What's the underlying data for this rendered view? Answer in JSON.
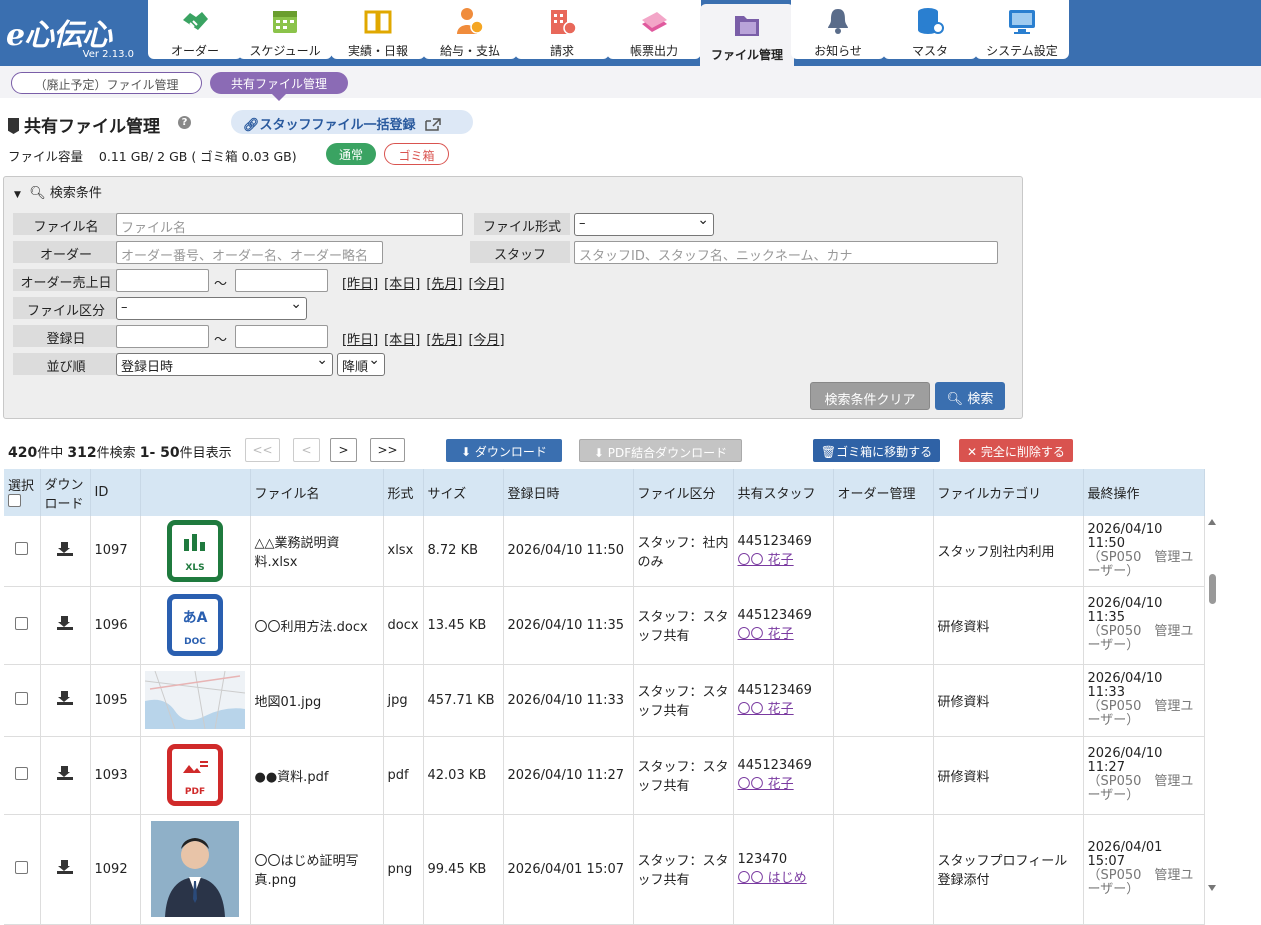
{
  "app": {
    "logo": "e心伝心",
    "version": "Ver 2.13.0"
  },
  "nav": [
    {
      "label": "オーダー",
      "icon": "handshake-icon"
    },
    {
      "label": "スケジュール",
      "icon": "calendar-icon"
    },
    {
      "label": "実績・日報",
      "icon": "book-icon"
    },
    {
      "label": "給与・支払",
      "icon": "payroll-icon"
    },
    {
      "label": "請求",
      "icon": "building-icon"
    },
    {
      "label": "帳票出力",
      "icon": "papers-icon"
    },
    {
      "label": "ファイル管理",
      "icon": "folder-icon"
    },
    {
      "label": "お知らせ",
      "icon": "bell-icon"
    },
    {
      "label": "マスタ",
      "icon": "database-icon"
    },
    {
      "label": "システム設定",
      "icon": "monitor-icon"
    }
  ],
  "subtabs": {
    "deprecated": "（廃止予定）ファイル管理",
    "shared": "共有ファイル管理"
  },
  "page": {
    "title": "共有ファイル管理",
    "help": "?",
    "bulk_register": "スタッフファイル一括登録",
    "capacity_label": "ファイル容量",
    "capacity_value": "0.11 GB/ 2 GB ( ゴミ箱 0.03 GB)",
    "badge_normal": "通常",
    "badge_trash": "ゴミ箱"
  },
  "search": {
    "header": "検索条件",
    "file_name_label": "ファイル名",
    "file_name_placeholder": "ファイル名",
    "file_format_label": "ファイル形式",
    "file_format_value": "–",
    "order_label": "オーダー",
    "order_placeholder": "オーダー番号、オーダー名、オーダー略名",
    "staff_label": "スタッフ",
    "staff_placeholder": "スタッフID、スタッフ名、ニックネーム、カナ",
    "order_sales_date_label": "オーダー売上日",
    "file_category_label": "ファイル区分",
    "file_category_value": "–",
    "reg_date_label": "登録日",
    "sort_label": "並び順",
    "sort_value": "登録日時",
    "sort_dir": "降順",
    "tilde": "～",
    "quick": [
      "[昨日]",
      "[本日]",
      "[先月]",
      "[今月]"
    ],
    "clear_button": "検索条件クリア",
    "search_button": "検索"
  },
  "results": {
    "total": "420",
    "total_suffix": "件中 ",
    "matched": "312",
    "matched_suffix": "件検索 ",
    "range": "1- 50",
    "range_suffix": "件目表示",
    "first": "<<",
    "prev": "<",
    "next": ">",
    "last": ">>",
    "download_button": "ダウンロード",
    "pdf_download_button": "PDF結合ダウンロード",
    "move_trash_button": "ゴミ箱に移動する",
    "delete_button": "完全に削除する"
  },
  "table": {
    "headers": {
      "select": "選択",
      "download": "ダウンロード",
      "id": "ID",
      "file_name": "ファイル名",
      "format": "形式",
      "size": "サイズ",
      "reg_date": "登録日時",
      "category": "ファイル区分",
      "shared_staff": "共有スタッフ",
      "order": "オーダー管理",
      "file_category": "ファイルカテゴリ",
      "last_op": "最終操作"
    },
    "rows": [
      {
        "id": "1097",
        "thumb": "XLS",
        "name": "△△業務説明資料.xlsx",
        "format": "xlsx",
        "size": "8.72 KB",
        "date": "2026/04/10 11:50",
        "kbn": "スタッフ：社内のみ",
        "staff_id": "445123469",
        "staff_name": "〇〇 花子",
        "order": "",
        "cat": "スタッフ別社内利用",
        "last_date": "2026/04/10 11:50",
        "last_user": "（SP050　管理ユーザー）"
      },
      {
        "id": "1096",
        "thumb": "DOC",
        "name": "〇〇利用方法.docx",
        "format": "docx",
        "size": "13.45 KB",
        "date": "2026/04/10 11:35",
        "kbn": "スタッフ：スタッフ共有",
        "staff_id": "445123469",
        "staff_name": "〇〇 花子",
        "order": "",
        "cat": "研修資料",
        "last_date": "2026/04/10 11:35",
        "last_user": "（SP050　管理ユーザー）"
      },
      {
        "id": "1095",
        "thumb": "MAP",
        "name": "地図01.jpg",
        "format": "jpg",
        "size": "457.71 KB",
        "date": "2026/04/10 11:33",
        "kbn": "スタッフ：スタッフ共有",
        "staff_id": "445123469",
        "staff_name": "〇〇 花子",
        "order": "",
        "cat": "研修資料",
        "last_date": "2026/04/10 11:33",
        "last_user": "（SP050　管理ユーザー）"
      },
      {
        "id": "1093",
        "thumb": "PDF",
        "name": "●●資料.pdf",
        "format": "pdf",
        "size": "42.03 KB",
        "date": "2026/04/10 11:27",
        "kbn": "スタッフ：スタッフ共有",
        "staff_id": "445123469",
        "staff_name": "〇〇 花子",
        "order": "",
        "cat": "研修資料",
        "last_date": "2026/04/10 11:27",
        "last_user": "（SP050　管理ユーザー）"
      },
      {
        "id": "1092",
        "thumb": "PHOTO",
        "name": "〇〇はじめ証明写真.png",
        "format": "png",
        "size": "99.45 KB",
        "date": "2026/04/01 15:07",
        "kbn": "スタッフ：スタッフ共有",
        "staff_id": "123470",
        "staff_name": "〇〇 はじめ",
        "order": "",
        "cat": "スタッフプロフィール登録添付",
        "last_date": "2026/04/01 15:07",
        "last_user": "（SP050　管理ユーザー）"
      }
    ]
  },
  "colors": {
    "nav": "#3a6fb0",
    "active_pill": "#8b6bb5",
    "xls": "#1f7a3e",
    "doc": "#2a5fb0",
    "pdf": "#d02a2a"
  }
}
